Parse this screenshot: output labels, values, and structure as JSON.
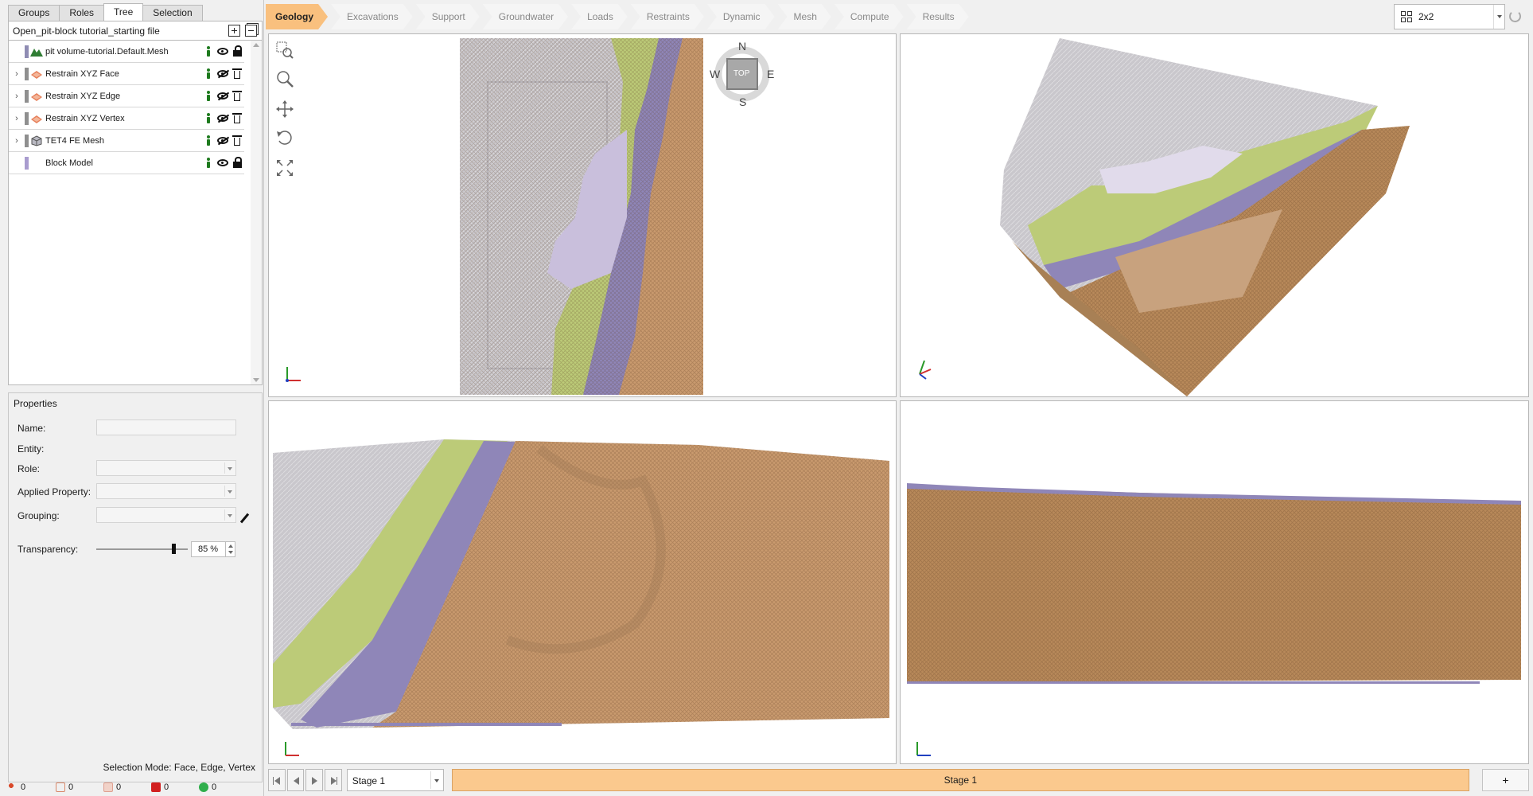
{
  "left_panel": {
    "tabs": [
      {
        "label": "Groups",
        "active": false
      },
      {
        "label": "Roles",
        "active": false
      },
      {
        "label": "Tree",
        "active": true
      },
      {
        "label": "Selection",
        "active": false
      }
    ],
    "tree_title": "Open_pit-block tutorial_starting file",
    "tree_items": [
      {
        "label": "pit volume-tutorial.Default.Mesh",
        "expandable": false,
        "swatch": "#8f8cb3",
        "icon": "mountain-icon",
        "visible": true,
        "locked": true
      },
      {
        "label": "Restrain XYZ Face",
        "expandable": true,
        "swatch": "#8f8f8f",
        "icon": "restraint-face-icon",
        "visible": false,
        "locked": false
      },
      {
        "label": "Restrain XYZ Edge",
        "expandable": true,
        "swatch": "#8f8f8f",
        "icon": "restraint-edge-icon",
        "visible": false,
        "locked": false
      },
      {
        "label": "Restrain XYZ Vertex",
        "expandable": true,
        "swatch": "#8f8f8f",
        "icon": "restraint-vertex-icon",
        "visible": false,
        "locked": false
      },
      {
        "label": "TET4 FE Mesh",
        "expandable": true,
        "swatch": "#8f8f8f",
        "icon": "cube-mesh-icon",
        "visible": false,
        "locked": false
      },
      {
        "label": "Block Model",
        "expandable": false,
        "swatch": "#a99ccf",
        "icon": "",
        "visible": true,
        "locked": true
      }
    ],
    "properties": {
      "title": "Properties",
      "name_label": "Name:",
      "entity_label": "Entity:",
      "role_label": "Role:",
      "applied_property_label": "Applied Property:",
      "grouping_label": "Grouping:",
      "transparency_label": "Transparency:",
      "transparency_value": "85 %",
      "transparency_fraction": 0.85
    },
    "selection_mode": "Selection Mode:  Face, Edge, Vertex",
    "status_counts": [
      {
        "icon": "vertex-count-icon",
        "value": "0",
        "color": "#d94a2b"
      },
      {
        "icon": "edge-count-icon",
        "value": "0",
        "color": "#d9896b"
      },
      {
        "icon": "face-count-icon",
        "value": "0",
        "color": "#e0a090"
      },
      {
        "icon": "volume-count-icon",
        "value": "0",
        "color": "#d22020"
      },
      {
        "icon": "group-count-icon",
        "value": "0",
        "color": "#2fae4b"
      }
    ]
  },
  "workflow_tabs": [
    {
      "label": "Geology",
      "active": true
    },
    {
      "label": "Excavations",
      "active": false
    },
    {
      "label": "Support",
      "active": false
    },
    {
      "label": "Groundwater",
      "active": false
    },
    {
      "label": "Loads",
      "active": false
    },
    {
      "label": "Restraints",
      "active": false
    },
    {
      "label": "Dynamic",
      "active": false
    },
    {
      "label": "Mesh",
      "active": false
    },
    {
      "label": "Compute",
      "active": false
    },
    {
      "label": "Results",
      "active": false
    }
  ],
  "layout_select": "2x2",
  "compass": {
    "n": "N",
    "s": "S",
    "e": "E",
    "w": "W",
    "center": "TOP"
  },
  "viewports": [
    {
      "name": "top-view"
    },
    {
      "name": "perspective-view"
    },
    {
      "name": "front-view"
    },
    {
      "name": "side-view"
    }
  ],
  "stages": {
    "selected": "Stage 1",
    "tabs": [
      "Stage 1"
    ],
    "add_label": "+"
  },
  "colors": {
    "accent": "#f9c07e",
    "stage_tab": "#fbc98e",
    "geology_grey": "#c9c7cc",
    "geology_green": "#bccb78",
    "geology_purple": "#8f86b8",
    "geology_lilac": "#c9bfdc",
    "geology_brown": "#b8895a"
  }
}
